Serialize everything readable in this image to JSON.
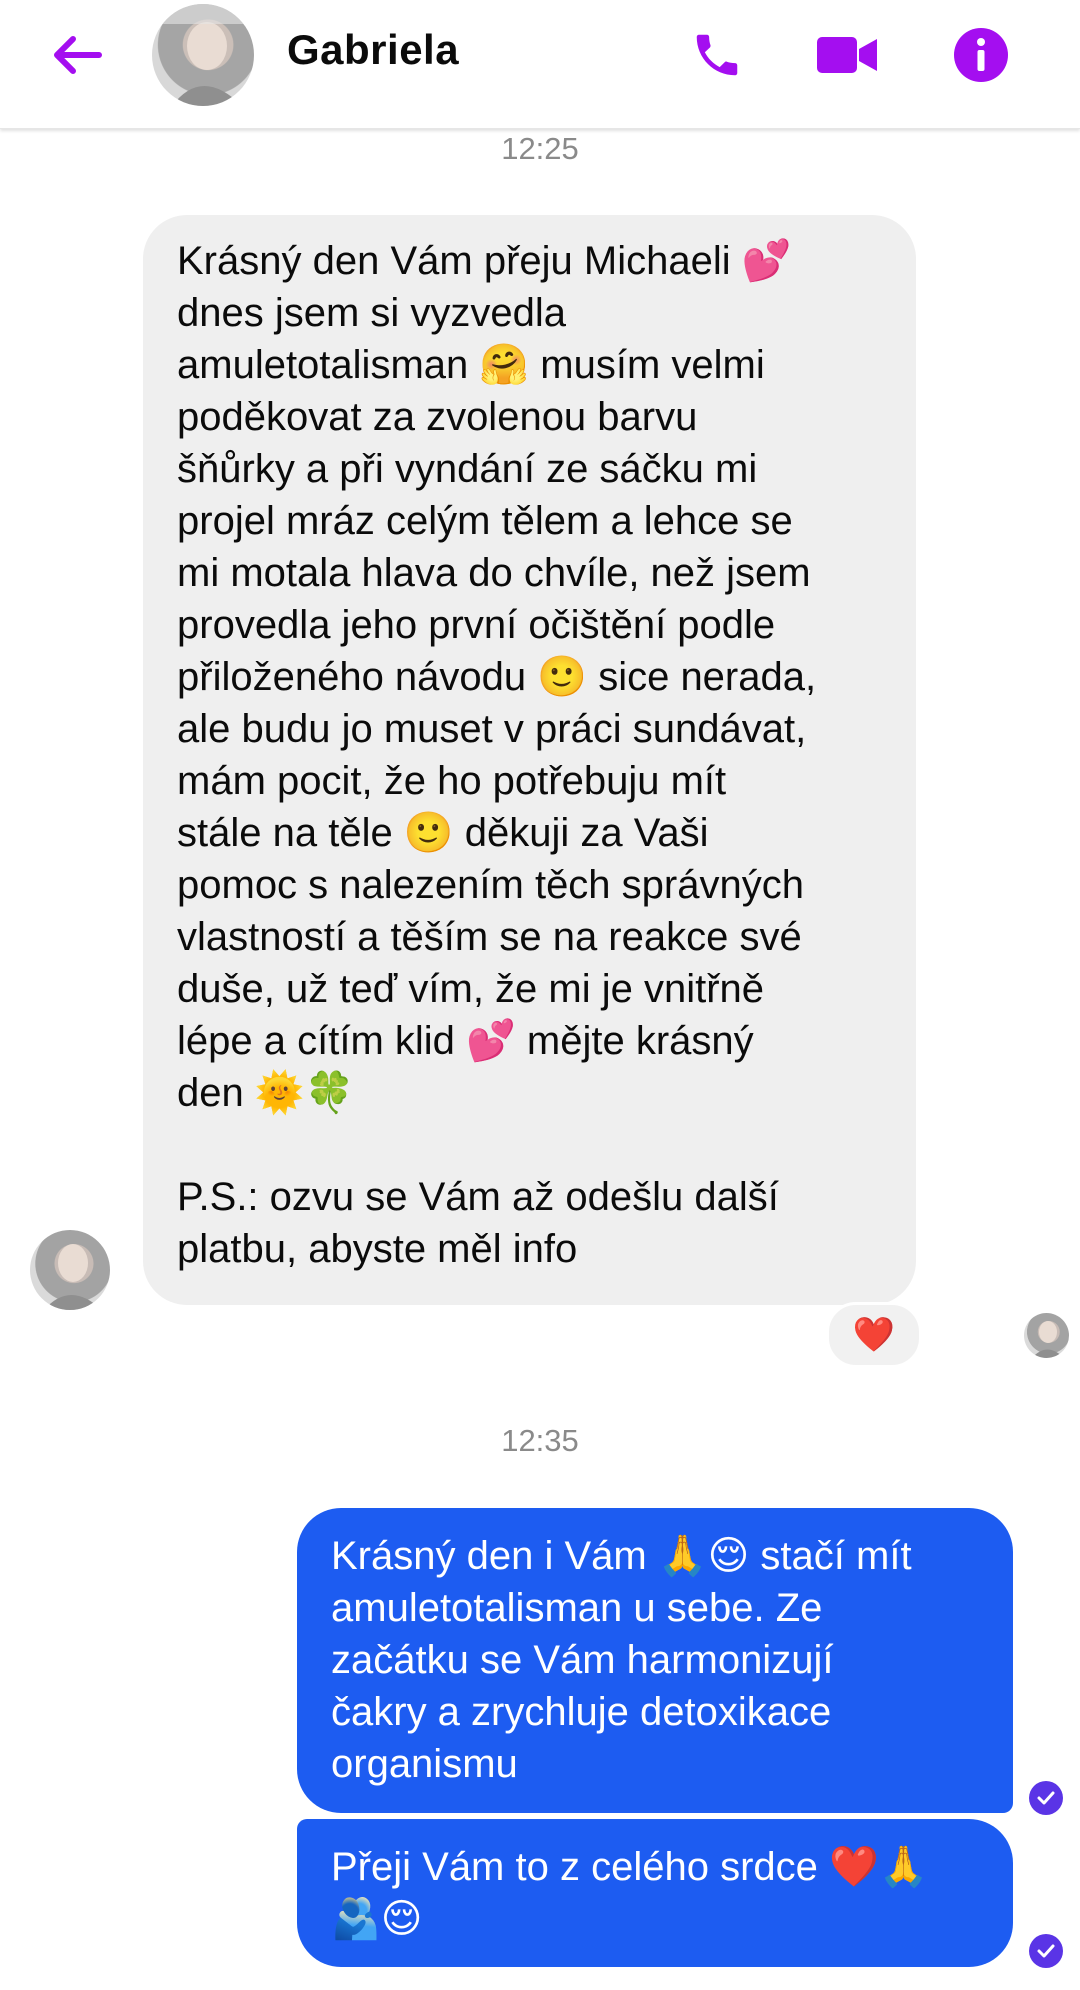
{
  "header": {
    "title": "Gabriela",
    "icons": [
      "back-arrow-icon",
      "phone-icon",
      "video-camera-icon",
      "info-icon"
    ],
    "accent_color": "#a40ef0"
  },
  "thread": {
    "timestamp_1": "12:25",
    "incoming_message": "Krásný den Vám přeju Michaeli 💕\ndnes jsem si vyzvedla\namuletotalisman 🤗 musím velmi\npoděkovat za zvolenou barvu\nšňůrky a při vyndání ze sáčku mi\nprojel mráz celým tělem a lehce se\nmi motala hlava do chvíle, než jsem\nprovedla jeho první očištění podle\npřiloženého návodu 🙂 sice nerada,\nale budu jo muset v práci sundávat,\nmám pocit, že ho potřebuju mít\nstále na těle 🙂 děkuji za Vaši\npomoc s nalezením těch správných\nvlastností a těším se na reakce své\nduše, už teď vím, že mi je vnitřně\nlépe a cítím klid 💕 mějte krásný\nden 🌞🍀\n\nP.S.: ozvu se Vám až odešlu další\nplatbu, abyste měl info",
    "reaction": "❤️",
    "timestamp_2": "12:35",
    "outgoing_message_1": "Krásný den i Vám 🙏😌 stačí mít\namuletotalisman u sebe. Ze\nzačátku se Vám harmonizují\nčakry a zrychluje detoxikace\norganismu",
    "outgoing_message_2": "Přeji Vám to z celého srdce ❤️🙏\n🫂😌",
    "colors": {
      "incoming_bubble": "#efefef",
      "outgoing_bubble": "#1d5cf1",
      "read_check": "#5a34e6",
      "timestamp_text": "#8a8a8a"
    }
  }
}
